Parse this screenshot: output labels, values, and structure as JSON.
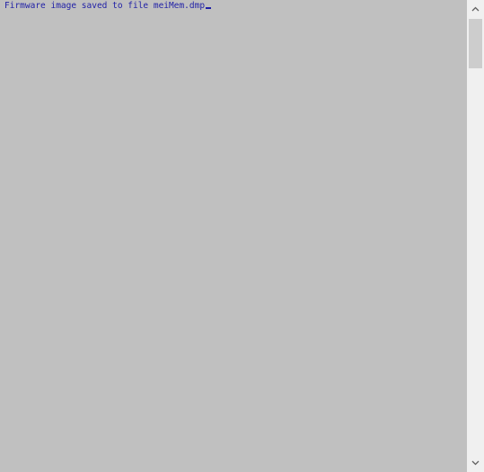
{
  "console": {
    "output_text": "Firmware image saved to file meiMem.dmp",
    "text_color": "#1f1fa6",
    "background_color": "#c0c0c0"
  },
  "scrollbar": {
    "up_icon": "chevron-up-icon",
    "down_icon": "chevron-down-icon",
    "thumb_position": 0
  }
}
